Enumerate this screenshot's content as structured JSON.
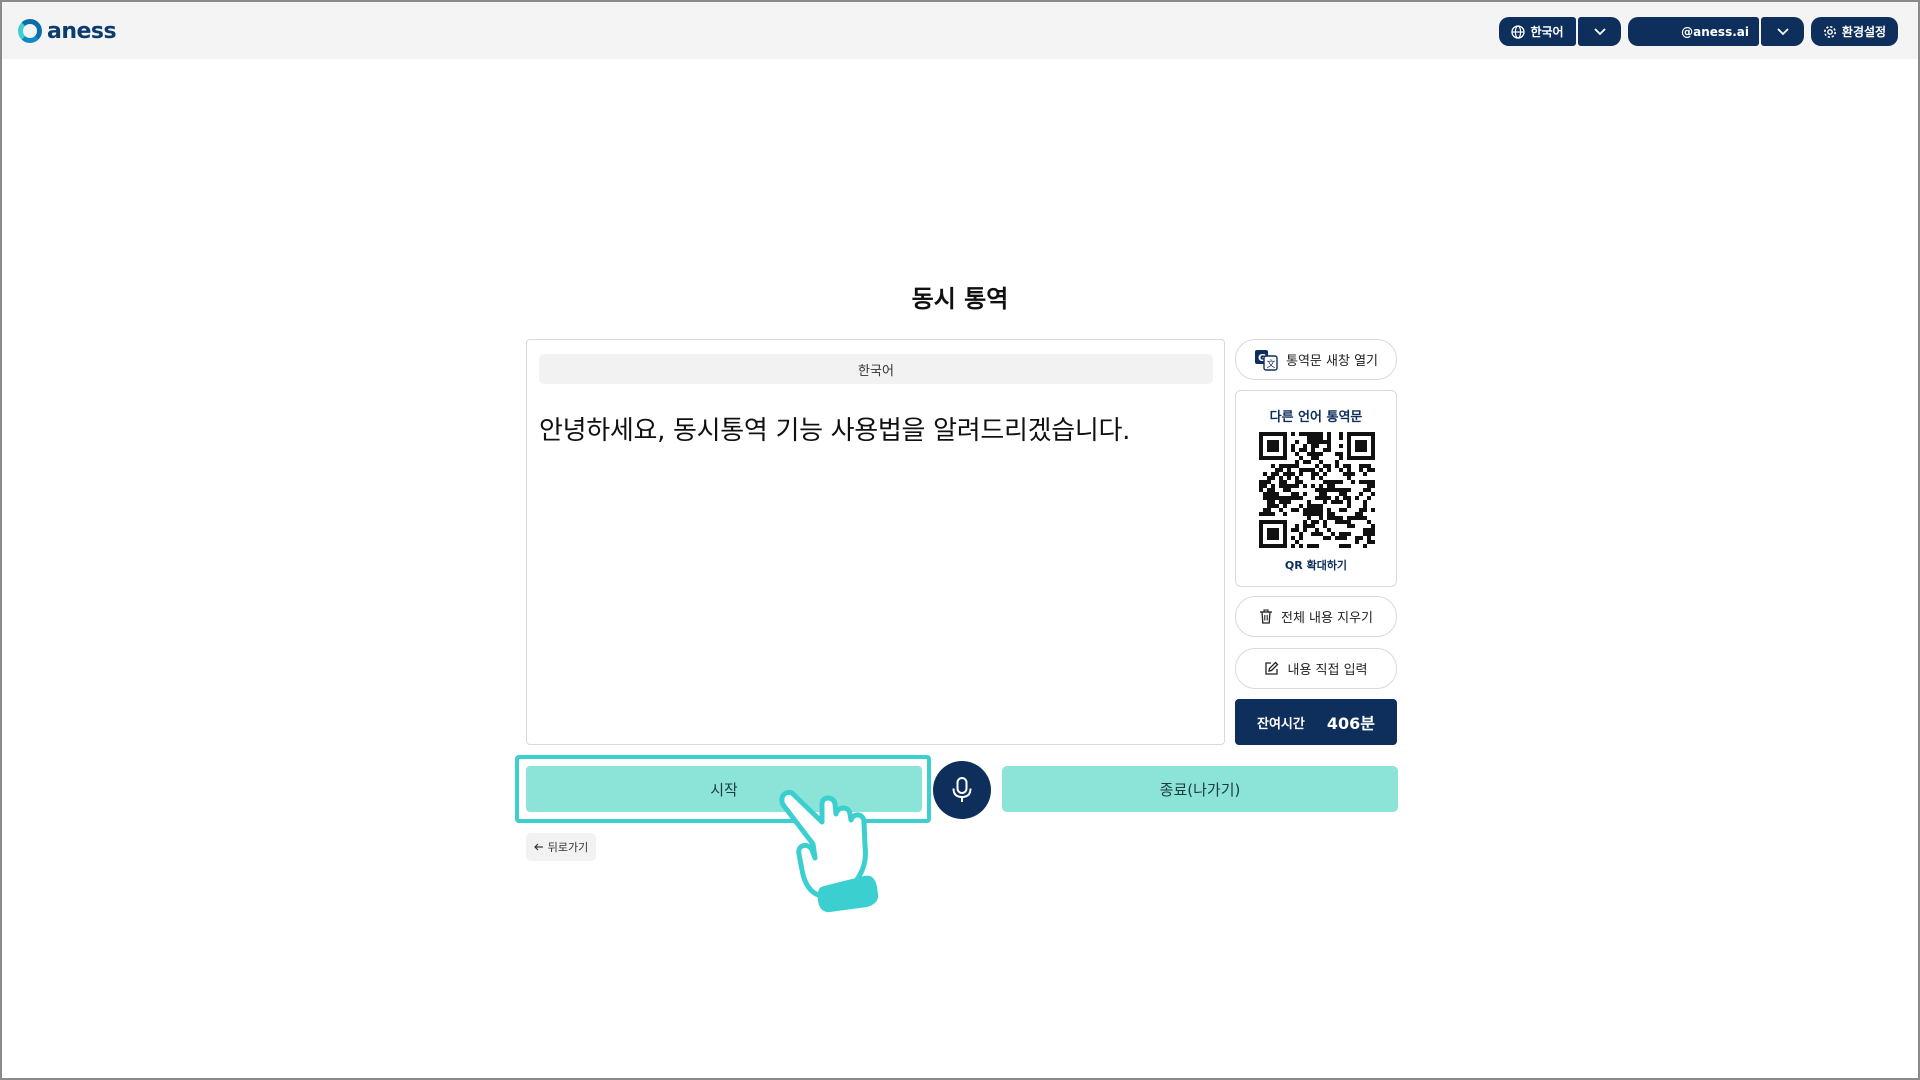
{
  "header": {
    "logo_text": "aness",
    "language_label": "한국어",
    "user_label": "@aness.ai",
    "settings_label": "환경설정"
  },
  "main": {
    "title": "동시 통역",
    "source_language": "한국어",
    "transcript": "안녕하세요, 동시통역 기능 사용법을 알려드리겠습니다."
  },
  "side": {
    "open_translation_label": "통역문 새창 열기",
    "qr_title": "다른 언어 통역문",
    "qr_expand_label": "QR 확대하기",
    "clear_all_label": "전체 내용 지우기",
    "direct_input_label": "내용 직접 입력",
    "remaining_label": "잔여시간",
    "remaining_value": "406분"
  },
  "controls": {
    "start_label": "시작",
    "end_label": "종료(나가기)",
    "back_label": "뒤로가기"
  },
  "colors": {
    "navy": "#0e2f5c",
    "mint": "#8ce3d8",
    "highlight": "#3ccfcf"
  }
}
